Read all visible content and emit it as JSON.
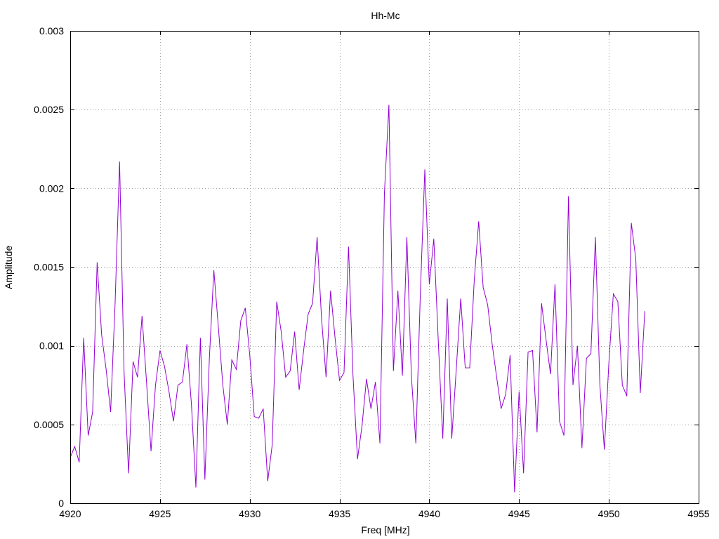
{
  "chart_data": {
    "type": "line",
    "title": "Hh-Mc",
    "xlabel": "Freq [MHz]",
    "ylabel": "Amplitude",
    "xlim": [
      4920,
      4955
    ],
    "ylim": [
      0,
      0.003
    ],
    "grid": true,
    "legend": "none",
    "x_ticks": [
      "4920",
      "4925",
      "4930",
      "4935",
      "4940",
      "4945",
      "4950",
      "4955"
    ],
    "y_ticks": [
      "0",
      "0.0005",
      "0.001",
      "0.0015",
      "0.002",
      "0.0025",
      "0.003"
    ],
    "series": [
      {
        "color": "#9400d3",
        "x_start": 4920,
        "x_step": 0.25,
        "values": [
          0.00029,
          0.00036,
          0.00026,
          0.00105,
          0.00043,
          0.00058,
          0.00153,
          0.00107,
          0.00085,
          0.00058,
          0.00127,
          0.00217,
          0.00083,
          0.00019,
          0.0009,
          0.0008,
          0.00119,
          0.00077,
          0.00033,
          0.00075,
          0.00097,
          0.00087,
          0.00071,
          0.00052,
          0.00075,
          0.00077,
          0.00101,
          0.00063,
          0.0001,
          0.00105,
          0.00015,
          0.00092,
          0.00148,
          0.00112,
          0.00075,
          0.0005,
          0.00091,
          0.00085,
          0.00116,
          0.00124,
          0.00094,
          0.00055,
          0.00054,
          0.0006,
          0.00014,
          0.00037,
          0.00128,
          0.00109,
          0.0008,
          0.00084,
          0.00109,
          0.00072,
          0.00097,
          0.0012,
          0.00127,
          0.00169,
          0.00117,
          0.0008,
          0.00135,
          0.00105,
          0.00078,
          0.00083,
          0.00163,
          0.00081,
          0.00028,
          0.00049,
          0.00079,
          0.0006,
          0.00077,
          0.00038,
          0.00197,
          0.00253,
          0.00084,
          0.00135,
          0.00081,
          0.00169,
          0.00081,
          0.00038,
          0.00133,
          0.00212,
          0.00139,
          0.00168,
          0.00103,
          0.00041,
          0.0013,
          0.00041,
          0.00085,
          0.0013,
          0.00086,
          0.00086,
          0.00141,
          0.00179,
          0.00137,
          0.00126,
          0.00101,
          0.0008,
          0.0006,
          0.00069,
          0.00094,
          7e-05,
          0.00071,
          0.00019,
          0.00096,
          0.00097,
          0.00045,
          0.00127,
          0.00104,
          0.00082,
          0.00139,
          0.00052,
          0.00043,
          0.00195,
          0.00075,
          0.001,
          0.00035,
          0.00092,
          0.00095,
          0.00169,
          0.00075,
          0.00034,
          0.00089,
          0.00133,
          0.00128,
          0.00075,
          0.00068,
          0.00178,
          0.00155,
          0.0007,
          0.00122
        ]
      }
    ]
  }
}
